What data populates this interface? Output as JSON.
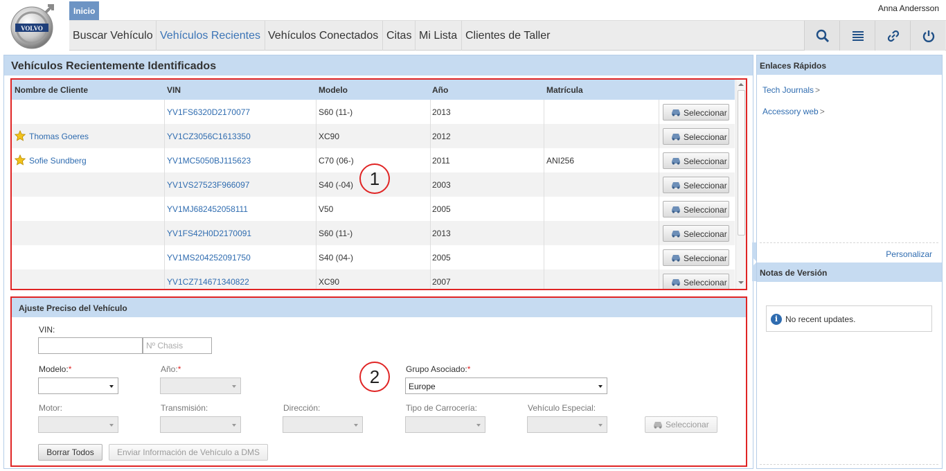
{
  "header": {
    "user_name": "Anna Andersson",
    "home_tab": "Inicio",
    "nav": [
      "Buscar Vehículo",
      "Vehículos Recientes",
      "Vehículos Conectados",
      "Citas",
      "Mi Lista",
      "Clientes de Taller"
    ],
    "active_nav": "Vehículos Recientes",
    "icons": [
      "search-icon",
      "list-icon",
      "link-icon",
      "power-icon"
    ],
    "logo_text": "VOLVO"
  },
  "main": {
    "title": "Vehículos Recientemente Identificados",
    "recent": {
      "columns": [
        "Nombre de Cliente",
        "VIN",
        "Modelo",
        "Año",
        "Matrícula"
      ],
      "select_label": "Seleccionar",
      "rows": [
        {
          "customer": "",
          "favorite": false,
          "vin": "YV1FS6320D2170077",
          "model": "S60 (11-)",
          "year": "2013",
          "plate": ""
        },
        {
          "customer": "Thomas Goeres",
          "favorite": true,
          "vin": "YV1CZ3056C1613350",
          "model": "XC90",
          "year": "2012",
          "plate": ""
        },
        {
          "customer": "Sofie Sundberg",
          "favorite": true,
          "vin": "YV1MC5050BJ115623",
          "model": "C70 (06-)",
          "year": "2011",
          "plate": "ANI256"
        },
        {
          "customer": "",
          "favorite": false,
          "vin": "YV1VS27523F966097",
          "model": "S40 (-04)",
          "year": "2003",
          "plate": ""
        },
        {
          "customer": "",
          "favorite": false,
          "vin": "YV1MJ682452058111",
          "model": "V50",
          "year": "2005",
          "plate": ""
        },
        {
          "customer": "",
          "favorite": false,
          "vin": "YV1FS42H0D2170091",
          "model": "S60 (11-)",
          "year": "2013",
          "plate": ""
        },
        {
          "customer": "",
          "favorite": false,
          "vin": "YV1MS204252091750",
          "model": "S40 (04-)",
          "year": "2005",
          "plate": ""
        },
        {
          "customer": "",
          "favorite": false,
          "vin": "YV1CZ714671340822",
          "model": "XC90",
          "year": "2007",
          "plate": ""
        }
      ]
    },
    "callout_1": "1",
    "callout_2": "2",
    "adjust": {
      "title": "Ajuste Preciso del Vehículo",
      "vin_label": "VIN:",
      "vin_value": "",
      "chassis_placeholder": "Nº Chasis",
      "model_label": "Modelo:",
      "model_value": "",
      "year_label": "Año:",
      "year_value": "",
      "group_label": "Grupo Asociado:",
      "group_value": "Europe",
      "required_mark": "*",
      "engine_label": "Motor:",
      "transmission_label": "Transmisión:",
      "steering_label": "Dirección:",
      "body_label": "Tipo de Carrocería:",
      "special_label": "Vehículo Especial:",
      "select_label": "Seleccionar",
      "clear_label": "Borrar Todos",
      "send_label": "Enviar Información de Vehículo a DMS"
    }
  },
  "right": {
    "quick_links_title": "Enlaces Rápidos",
    "links": [
      "Tech Journals",
      "Accessory web"
    ],
    "link_arrow": ">",
    "customize": "Personalizar",
    "release_notes_title": "Notas de Versión",
    "release_notes_text": "No recent updates."
  }
}
